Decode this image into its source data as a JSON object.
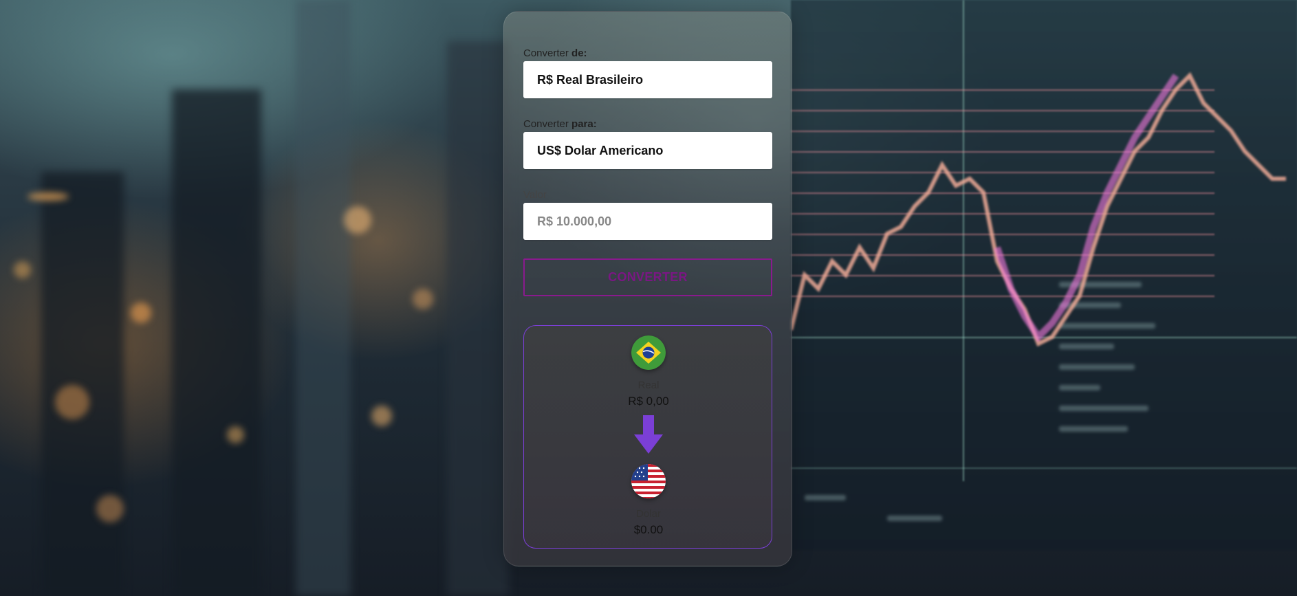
{
  "form": {
    "from_label_prefix": "Converter",
    "from_label_bold": "de:",
    "from_value": "R$ Real Brasileiro",
    "to_label_prefix": "Converter",
    "to_label_bold": "para:",
    "to_value": "US$ Dolar Americano",
    "amount_label": "Valor",
    "amount_placeholder": "R$ 10.000,00",
    "convert_button": "CONVERTER"
  },
  "result": {
    "from_currency_name": "Real",
    "from_currency_value": "R$ 0,00",
    "to_currency_name": "Dolar",
    "to_currency_value": "$0.00",
    "from_flag_icon": "brazil-flag-icon",
    "to_flag_icon": "usa-flag-icon",
    "arrow_icon": "arrow-down-icon"
  },
  "colors": {
    "accent_purple": "#7b3fd6",
    "button_magenta": "#8a1a8e"
  }
}
